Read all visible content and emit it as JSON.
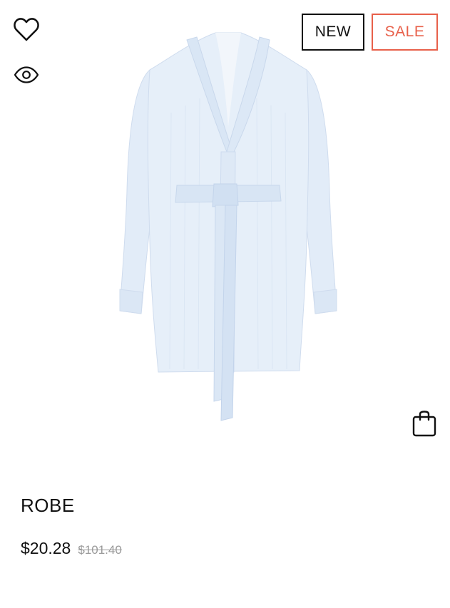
{
  "product": {
    "name": "ROBE",
    "price_current": "$20.28",
    "price_original": "$101.40",
    "image_alt": "Light blue ribbed robe with tie belt",
    "image_color": "#e4eef9"
  },
  "badges": {
    "new_label": "NEW",
    "sale_label": "SALE",
    "sale_color": "#e8604a"
  },
  "actions": {
    "wishlist_icon": "heart-icon",
    "quickview_icon": "eye-icon",
    "bag_icon": "shopping-bag-icon"
  }
}
